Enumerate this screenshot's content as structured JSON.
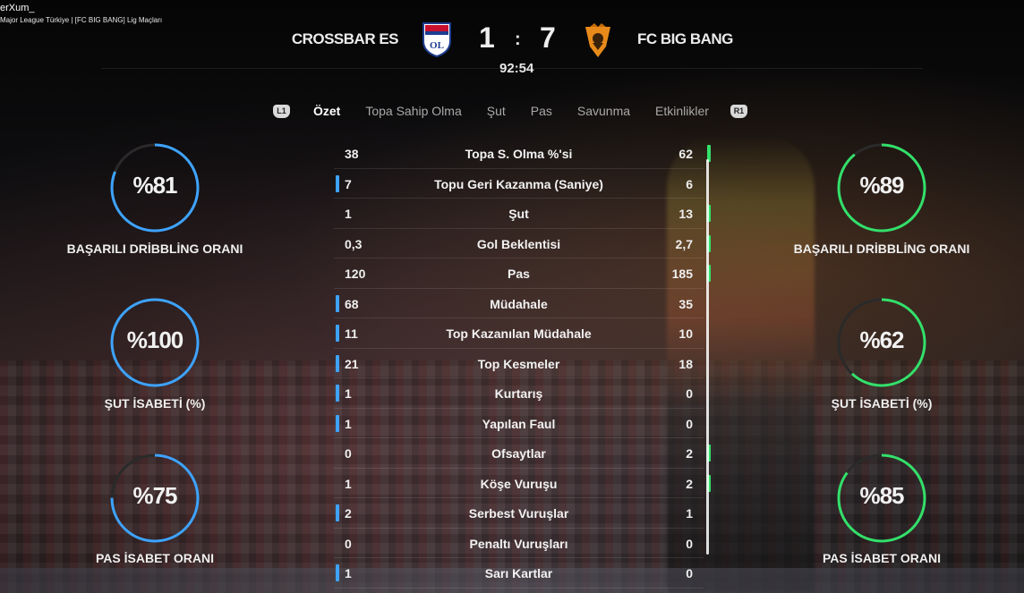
{
  "stream": {
    "title": "erXum_",
    "subtitle": "Major League Türkiye | [FC BIG BANG] Lig Maçları"
  },
  "match": {
    "home_team": "CROSSBAR ES",
    "away_team": "FC BIG BANG",
    "home_score": "1",
    "separator": ":",
    "away_score": "7",
    "clock": "92:54"
  },
  "tabs": {
    "left_shoulder": "L1",
    "right_shoulder": "R1",
    "items": [
      "Özet",
      "Topa Sahip Olma",
      "Şut",
      "Pas",
      "Savunma",
      "Etkinlikler"
    ],
    "active": "Özet"
  },
  "home_panel": [
    {
      "value": "%81",
      "label": "BAŞARILI DRİBBLİNG ORANI",
      "fraction": 0.81
    },
    {
      "value": "%100",
      "label": "ŞUT İSABETİ (%)",
      "fraction": 1.0
    },
    {
      "value": "%75",
      "label": "PAS İSABET ORANI",
      "fraction": 0.75
    }
  ],
  "away_panel": [
    {
      "value": "%89",
      "label": "BAŞARILI DRİBBLİNG ORANI",
      "fraction": 0.89
    },
    {
      "value": "%62",
      "label": "ŞUT İSABETİ (%)",
      "fraction": 0.62
    },
    {
      "value": "%85",
      "label": "PAS İSABET ORANI",
      "fraction": 0.85
    }
  ],
  "stats": [
    {
      "label": "Topa S. Olma %'si",
      "home": "38",
      "away": "62",
      "leader": "away"
    },
    {
      "label": "Topu Geri Kazanma (Saniye)",
      "home": "7",
      "away": "6",
      "leader": "home"
    },
    {
      "label": "Şut",
      "home": "1",
      "away": "13",
      "leader": "away"
    },
    {
      "label": "Gol Beklentisi",
      "home": "0,3",
      "away": "2,7",
      "leader": "away"
    },
    {
      "label": "Pas",
      "home": "120",
      "away": "185",
      "leader": "away"
    },
    {
      "label": "Müdahale",
      "home": "68",
      "away": "35",
      "leader": "home"
    },
    {
      "label": "Top Kazanılan Müdahale",
      "home": "11",
      "away": "10",
      "leader": "home"
    },
    {
      "label": "Top Kesmeler",
      "home": "21",
      "away": "18",
      "leader": "home"
    },
    {
      "label": "Kurtarış",
      "home": "1",
      "away": "0",
      "leader": "home"
    },
    {
      "label": "Yapılan Faul",
      "home": "1",
      "away": "0",
      "leader": "home"
    },
    {
      "label": "Ofsaytlar",
      "home": "0",
      "away": "2",
      "leader": "away"
    },
    {
      "label": "Köşe Vuruşu",
      "home": "1",
      "away": "2",
      "leader": "away"
    },
    {
      "label": "Serbest Vuruşlar",
      "home": "2",
      "away": "1",
      "leader": "home"
    },
    {
      "label": "Penaltı Vuruşları",
      "home": "0",
      "away": "0",
      "leader": "none"
    },
    {
      "label": "Sarı Kartlar",
      "home": "1",
      "away": "0",
      "leader": "home"
    }
  ],
  "colors": {
    "home_accent": "#3ea3ff",
    "away_accent": "#33e06a",
    "ring_track": "#2a2a2a"
  },
  "icons": {
    "home_crest": "olympique-lyonnais-crest",
    "away_crest": "fc-big-bang-crest"
  }
}
